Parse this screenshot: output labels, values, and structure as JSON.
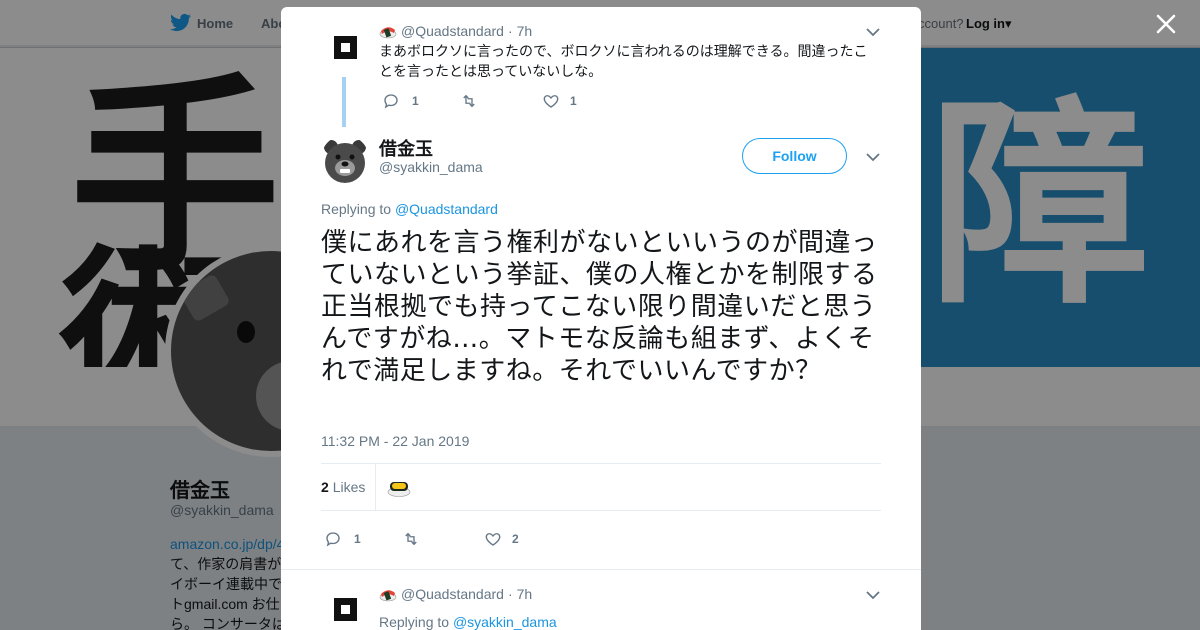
{
  "background": {
    "nav": {
      "home": "Home",
      "about": "Abo",
      "account": "ccount?",
      "login": "Log in"
    },
    "profile": {
      "name": "借金玉",
      "handle": "@syakkin_dama",
      "bio_lines": [
        "amazon.co.jp/dp/4",
        "て、作家の肩書が",
        "イボーイ連載中で",
        "トgmail.com お仕",
        "ら。 コンサータは"
      ]
    },
    "banner_glyphs": {
      "a": "手",
      "b": "術",
      "c": "障"
    }
  },
  "modal": {
    "context_tweet": {
      "handle": "@Quadstandard",
      "time": "7h",
      "text": "まあボロクソに言ったので、ボロクソに言われるのは理解できる。間違ったことを言ったとは思っていないしな。",
      "reply_count": "1",
      "retweet_count": "",
      "like_count": "1"
    },
    "main_tweet": {
      "name": "借金玉",
      "handle": "@syakkin_dama",
      "follow_label": "Follow",
      "replying_label": "Replying to",
      "replying_mention": "@Quadstandard",
      "text": "僕にあれを言う権利がないといいうのが間違っていないという挙証、僕の人権とかを制限する正当根拠でも持ってこない限り間違いだと思うんですがね…。マトモな反論も組まず、よくそれで満足しますね。それでいいんですか？",
      "timestamp": "11:32 PM - 22 Jan 2019",
      "likes_count": "2",
      "likes_label": "Likes",
      "reply_count": "1",
      "retweet_count": "",
      "like_count": "2"
    },
    "reply_tweet": {
      "handle": "@Quadstandard",
      "time": "7h",
      "replying_label": "Replying to",
      "replying_mention": "@syakkin_dama"
    }
  },
  "colors": {
    "accent": "#1da1f2",
    "link": "#1b95e0",
    "muted": "#657786",
    "thread": "#a7d1f2",
    "banner_blue": "#2a8ec6"
  }
}
